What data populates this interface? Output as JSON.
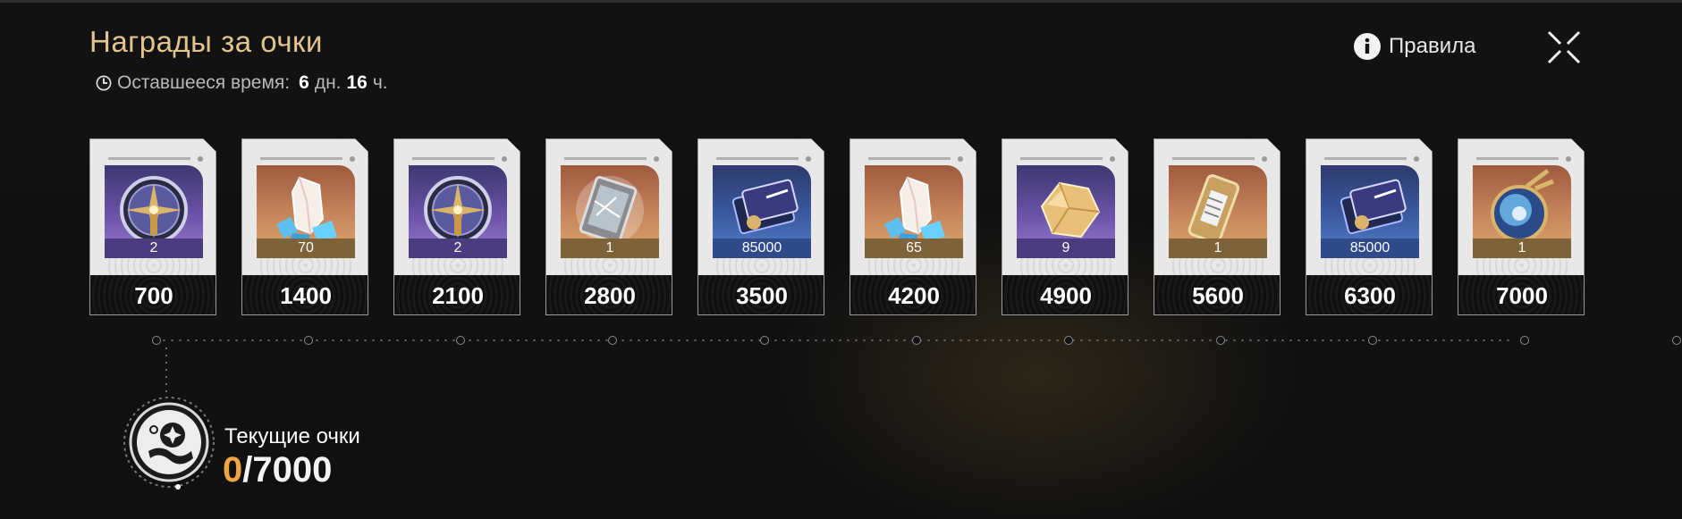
{
  "header": {
    "title": "Награды за очки",
    "timer": {
      "label": "Оставшееся время:",
      "days": "6",
      "days_unit": "дн.",
      "hours": "16",
      "hours_unit": "ч."
    },
    "rules_label": "Правила"
  },
  "rewards": [
    {
      "item_icon": "compass-sigil-icon",
      "amount": "2",
      "points": "700",
      "bg": "purple"
    },
    {
      "item_icon": "crystal-icon",
      "amount": "70",
      "points": "1400",
      "bg": "orange"
    },
    {
      "item_icon": "compass-sigil-icon",
      "amount": "2",
      "points": "2100",
      "bg": "purple"
    },
    {
      "item_icon": "data-card-icon",
      "amount": "1",
      "points": "2800",
      "bg": "orange"
    },
    {
      "item_icon": "currency-ticket-icon",
      "amount": "85000",
      "points": "3500",
      "bg": "blue"
    },
    {
      "item_icon": "crystal-icon",
      "amount": "65",
      "points": "4200",
      "bg": "orange"
    },
    {
      "item_icon": "gold-ore-icon",
      "amount": "9",
      "points": "4900",
      "bg": "purple"
    },
    {
      "item_icon": "keycard-icon",
      "amount": "1",
      "points": "5600",
      "bg": "orange"
    },
    {
      "item_icon": "currency-ticket-icon",
      "amount": "85000",
      "points": "6300",
      "bg": "blue"
    },
    {
      "item_icon": "orb-icon",
      "amount": "1",
      "points": "7000",
      "bg": "orange"
    }
  ],
  "progress": {
    "label": "Текущие очки",
    "current": "0",
    "max": "/7000",
    "fraction": 0
  },
  "colors": {
    "title": "#e0c58e",
    "current_points": "#f0a540",
    "background": "#121212"
  }
}
